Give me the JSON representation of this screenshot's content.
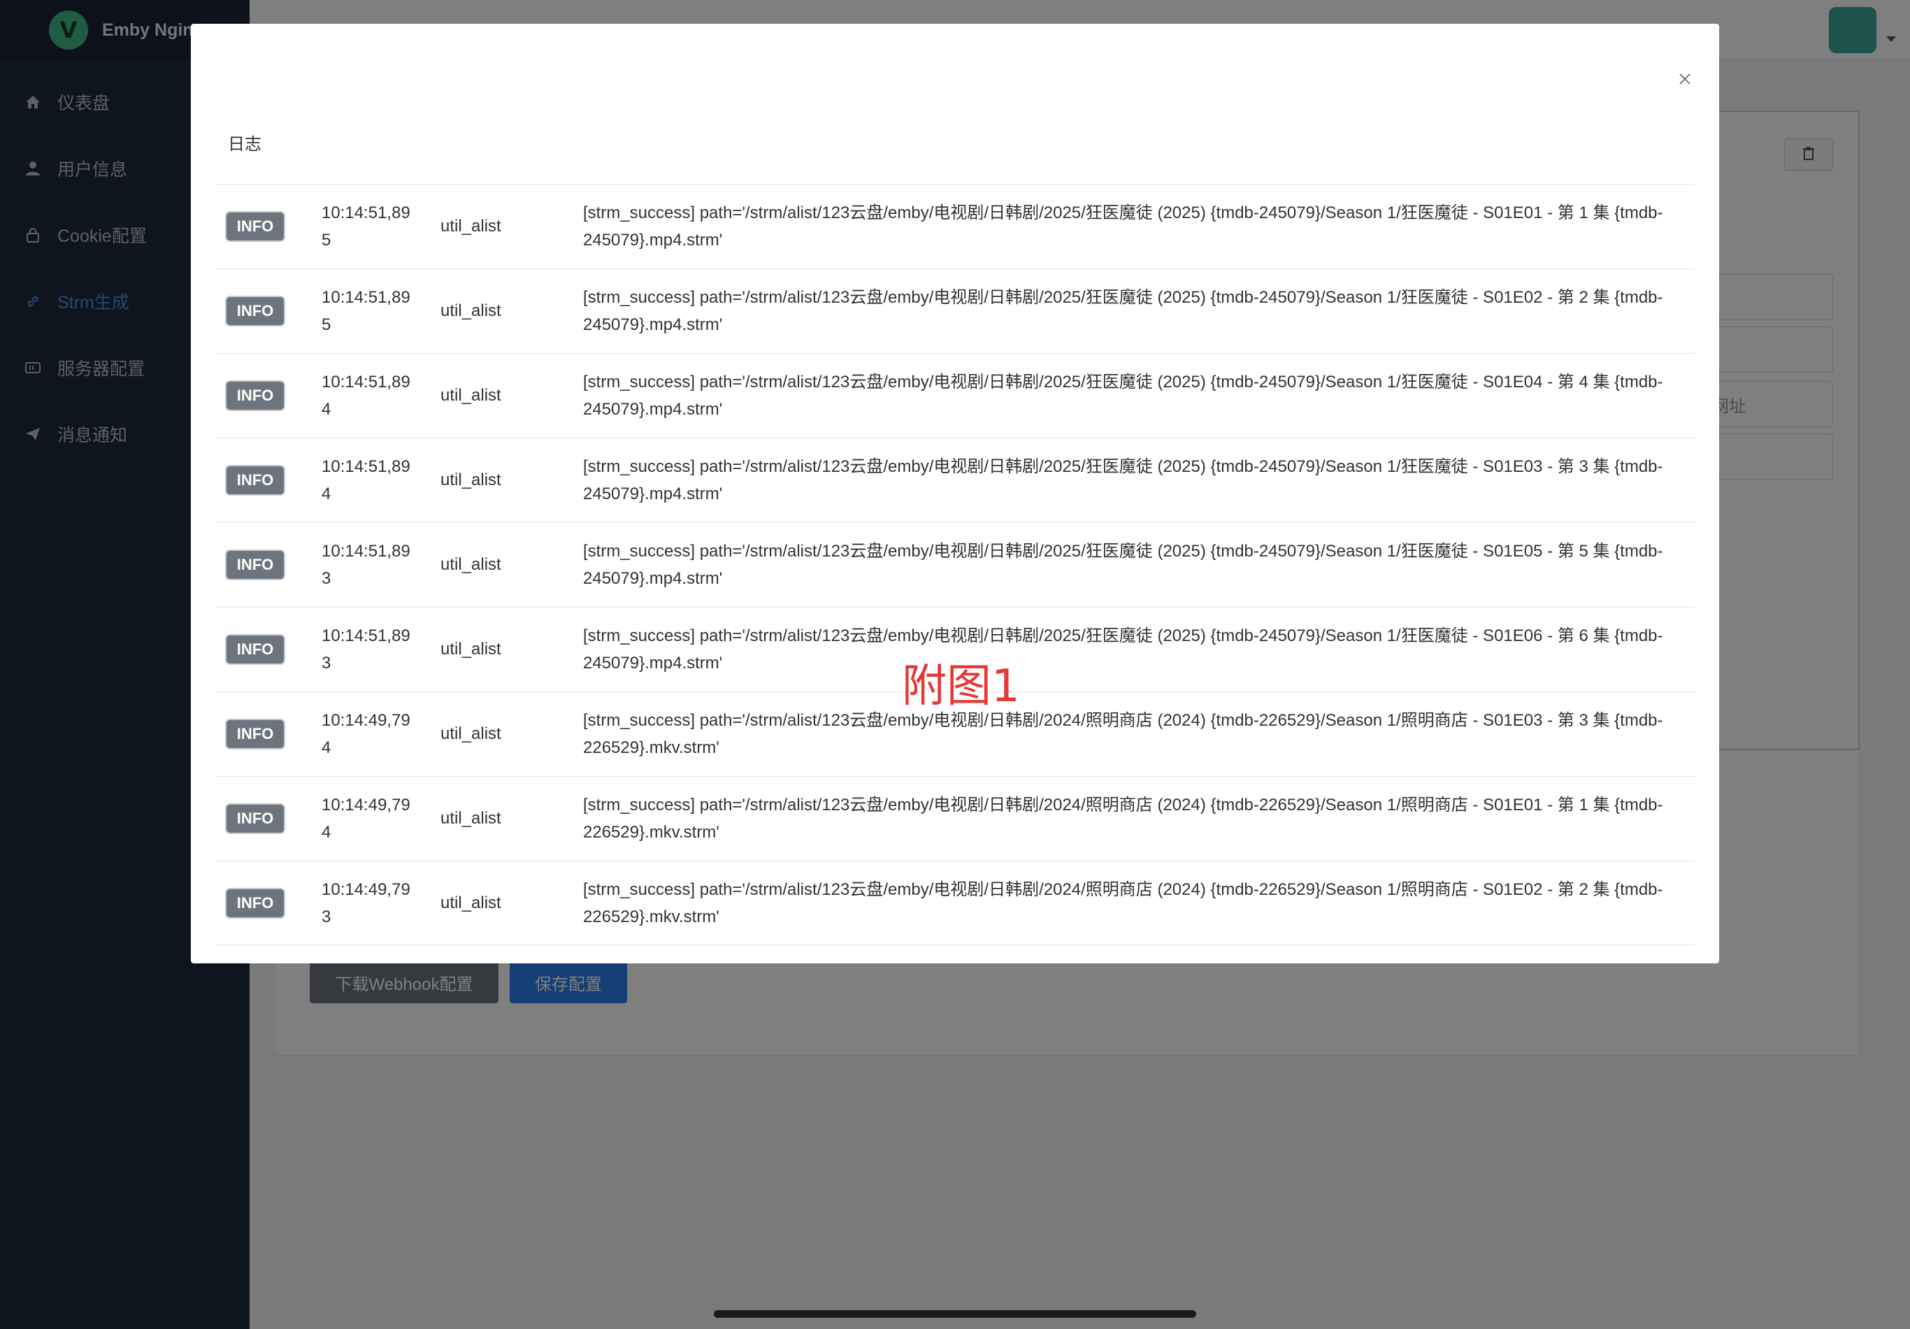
{
  "brand": {
    "logo_letter": "V",
    "name": "Emby Nginx"
  },
  "sidebar": {
    "items": [
      {
        "label": "仪表盘",
        "icon": "home-icon"
      },
      {
        "label": "用户信息",
        "icon": "user-icon"
      },
      {
        "label": "Cookie配置",
        "icon": "lock-icon"
      },
      {
        "label": "Strm生成",
        "icon": "link-icon",
        "active": true
      },
      {
        "label": "服务器配置",
        "icon": "server-icon"
      },
      {
        "label": "消息通知",
        "icon": "paper-plane-icon"
      }
    ]
  },
  "background": {
    "download_button": "下载Webhook配置",
    "save_button": "保存配置",
    "partial_field_text": "访网址"
  },
  "modal": {
    "title": "日志",
    "rows": [
      {
        "level": "INFO",
        "time": "10:14:51,895",
        "module": "util_alist",
        "message": "[strm_success] path='/strm/alist/123云盘/emby/电视剧/日韩剧/2025/狂医魔徒 (2025) {tmdb-245079}/Season 1/狂医魔徒 - S01E01 - 第 1 集 {tmdb-245079}.mp4.strm'"
      },
      {
        "level": "INFO",
        "time": "10:14:51,895",
        "module": "util_alist",
        "message": "[strm_success] path='/strm/alist/123云盘/emby/电视剧/日韩剧/2025/狂医魔徒 (2025) {tmdb-245079}/Season 1/狂医魔徒 - S01E02 - 第 2 集 {tmdb-245079}.mp4.strm'"
      },
      {
        "level": "INFO",
        "time": "10:14:51,894",
        "module": "util_alist",
        "message": "[strm_success] path='/strm/alist/123云盘/emby/电视剧/日韩剧/2025/狂医魔徒 (2025) {tmdb-245079}/Season 1/狂医魔徒 - S01E04 - 第 4 集 {tmdb-245079}.mp4.strm'"
      },
      {
        "level": "INFO",
        "time": "10:14:51,894",
        "module": "util_alist",
        "message": "[strm_success] path='/strm/alist/123云盘/emby/电视剧/日韩剧/2025/狂医魔徒 (2025) {tmdb-245079}/Season 1/狂医魔徒 - S01E03 - 第 3 集 {tmdb-245079}.mp4.strm'"
      },
      {
        "level": "INFO",
        "time": "10:14:51,893",
        "module": "util_alist",
        "message": "[strm_success] path='/strm/alist/123云盘/emby/电视剧/日韩剧/2025/狂医魔徒 (2025) {tmdb-245079}/Season 1/狂医魔徒 - S01E05 - 第 5 集 {tmdb-245079}.mp4.strm'"
      },
      {
        "level": "INFO",
        "time": "10:14:51,893",
        "module": "util_alist",
        "message": "[strm_success] path='/strm/alist/123云盘/emby/电视剧/日韩剧/2025/狂医魔徒 (2025) {tmdb-245079}/Season 1/狂医魔徒 - S01E06 - 第 6 集 {tmdb-245079}.mp4.strm'"
      },
      {
        "level": "INFO",
        "time": "10:14:49,794",
        "module": "util_alist",
        "message": "[strm_success] path='/strm/alist/123云盘/emby/电视剧/日韩剧/2024/照明商店 (2024) {tmdb-226529}/Season 1/照明商店 - S01E03 - 第 3 集 {tmdb-226529}.mkv.strm'"
      },
      {
        "level": "INFO",
        "time": "10:14:49,794",
        "module": "util_alist",
        "message": "[strm_success] path='/strm/alist/123云盘/emby/电视剧/日韩剧/2024/照明商店 (2024) {tmdb-226529}/Season 1/照明商店 - S01E01 - 第 1 集 {tmdb-226529}.mkv.strm'"
      },
      {
        "level": "INFO",
        "time": "10:14:49,793",
        "module": "util_alist",
        "message": "[strm_success] path='/strm/alist/123云盘/emby/电视剧/日韩剧/2024/照明商店 (2024) {tmdb-226529}/Season 1/照明商店 - S01E02 - 第 2 集 {tmdb-226529}.mkv.strm'"
      }
    ]
  },
  "watermark": "附图1",
  "colors": {
    "sidebar_bg": "#1e2a3d",
    "active_nav": "#4a90e2",
    "badge_bg": "#6c757d",
    "primary": "#2b7de9",
    "watermark": "#e53935"
  }
}
